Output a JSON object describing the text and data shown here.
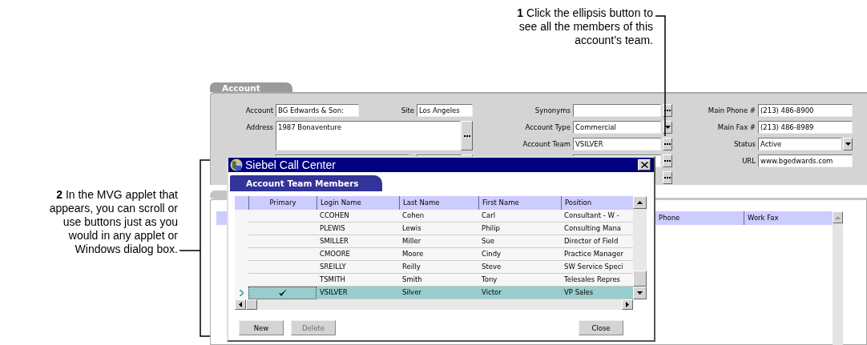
{
  "callouts": [
    {
      "text": "**1** Click the ellipsis button to see all the members of this account’s team."
    },
    {
      "text": "**2** In the MVG applet that appears, you can scroll or use buttons just as you would in any applet or Windows dialog box."
    }
  ],
  "account": {
    "tab": "Account",
    "account": {
      "label": "Account",
      "value": "BG Edwards & Son:"
    },
    "site": {
      "label": "Site",
      "value": "Los Angeles"
    },
    "address": {
      "label": "Address",
      "value": "1987 Bonaventure"
    },
    "middle": [
      {
        "label": "Synonyms",
        "kind": "ellipsis"
      },
      {
        "label": "Account Type",
        "value": "Commercial",
        "kind": "dropdown"
      },
      {
        "label": "Account Team",
        "value": "VSILVER",
        "kind": "ellipsis"
      },
      {
        "kind": "ellipsis"
      },
      {
        "kind": "button"
      }
    ],
    "right": [
      {
        "label": "Main Phone #",
        "value": "(213) 486-8900",
        "kind": "text"
      },
      {
        "label": "Main Fax #",
        "value": "(213) 486-8989",
        "kind": "text"
      },
      {
        "label": "Status",
        "value": "Active",
        "kind": "dropdown"
      },
      {
        "label": "URL",
        "value": "www.bgedwards.com",
        "kind": "text"
      }
    ]
  },
  "list": {
    "columns": [
      "Phone",
      "Work Fax"
    ]
  },
  "dialog": {
    "title": "Siebel Call Center",
    "tab": "Account Team Members",
    "columns": [
      "Primary",
      "Login Name",
      "Last Name",
      "First Name",
      "Position"
    ],
    "rows": [
      {
        "primary": false,
        "login": "CCOHEN",
        "last": "Cohen",
        "first": "Carl",
        "position": "Consultant - W -",
        "selected": false
      },
      {
        "primary": false,
        "login": "PLEWIS",
        "last": "Lewis",
        "first": "Philip",
        "position": "Consulting Mana",
        "selected": false
      },
      {
        "primary": false,
        "login": "SMILLER",
        "last": "Miller",
        "first": "Sue",
        "position": "Director of Field",
        "selected": false
      },
      {
        "primary": false,
        "login": "CMOORE",
        "last": "Moore",
        "first": "Cindy",
        "position": "Practice Manager",
        "selected": false
      },
      {
        "primary": false,
        "login": "SREILLY",
        "last": "Reilly",
        "first": "Steve",
        "position": "SW Service Speci",
        "selected": false
      },
      {
        "primary": false,
        "login": "TSMITH",
        "last": "Smith",
        "first": "Tony",
        "position": "Telesales Repres",
        "selected": false
      },
      {
        "primary": true,
        "login": "VSILVER",
        "last": "Silver",
        "first": "Victor",
        "position": "VP Sales",
        "selected": true
      }
    ],
    "buttons": [
      {
        "label": "New",
        "disabled": false,
        "kind": "left"
      },
      {
        "label": "Delete",
        "disabled": true,
        "kind": "left"
      },
      {
        "label": "Close",
        "disabled": false,
        "kind": "right"
      }
    ]
  }
}
